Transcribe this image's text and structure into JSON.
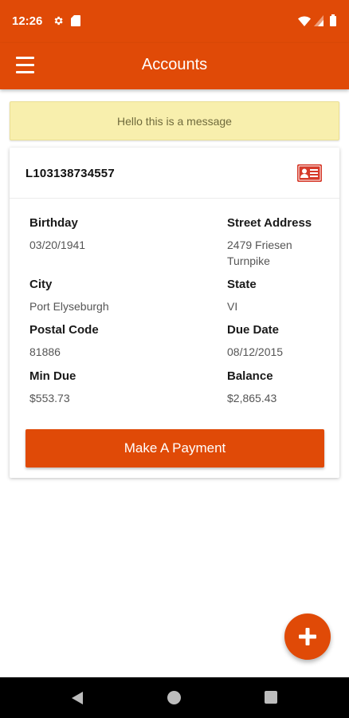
{
  "status_bar": {
    "time": "12:26",
    "icons": [
      "gear-icon",
      "sd-card-icon",
      "wifi-icon",
      "signal-icon",
      "battery-icon"
    ]
  },
  "app_bar": {
    "title": "Accounts",
    "menu_icon": "hamburger-menu-icon"
  },
  "message": {
    "text": "Hello this is a message"
  },
  "account": {
    "number": "L103138734557",
    "icon": "id-card-icon",
    "fields": {
      "birthday": {
        "label": "Birthday",
        "value": "03/20/1941"
      },
      "street_address": {
        "label": "Street Address",
        "value_line1": "2479 Friesen",
        "value_line2": "Turnpike"
      },
      "city": {
        "label": "City",
        "value": "Port Elyseburgh"
      },
      "state": {
        "label": "State",
        "value": "VI"
      },
      "postal_code": {
        "label": "Postal Code",
        "value": "81886"
      },
      "due_date": {
        "label": "Due Date",
        "value": "08/12/2015"
      },
      "min_due": {
        "label": "Min Due",
        "value": "$553.73"
      },
      "balance": {
        "label": "Balance",
        "value": "$2,865.43"
      }
    },
    "pay_button_label": "Make A Payment"
  },
  "fab": {
    "icon": "plus-icon"
  },
  "nav_bar": {
    "icons": [
      "back-icon",
      "home-icon",
      "recents-icon"
    ]
  },
  "colors": {
    "primary": "#e04a07",
    "message_bg": "#f8efad",
    "message_text": "#6f6a3c"
  }
}
